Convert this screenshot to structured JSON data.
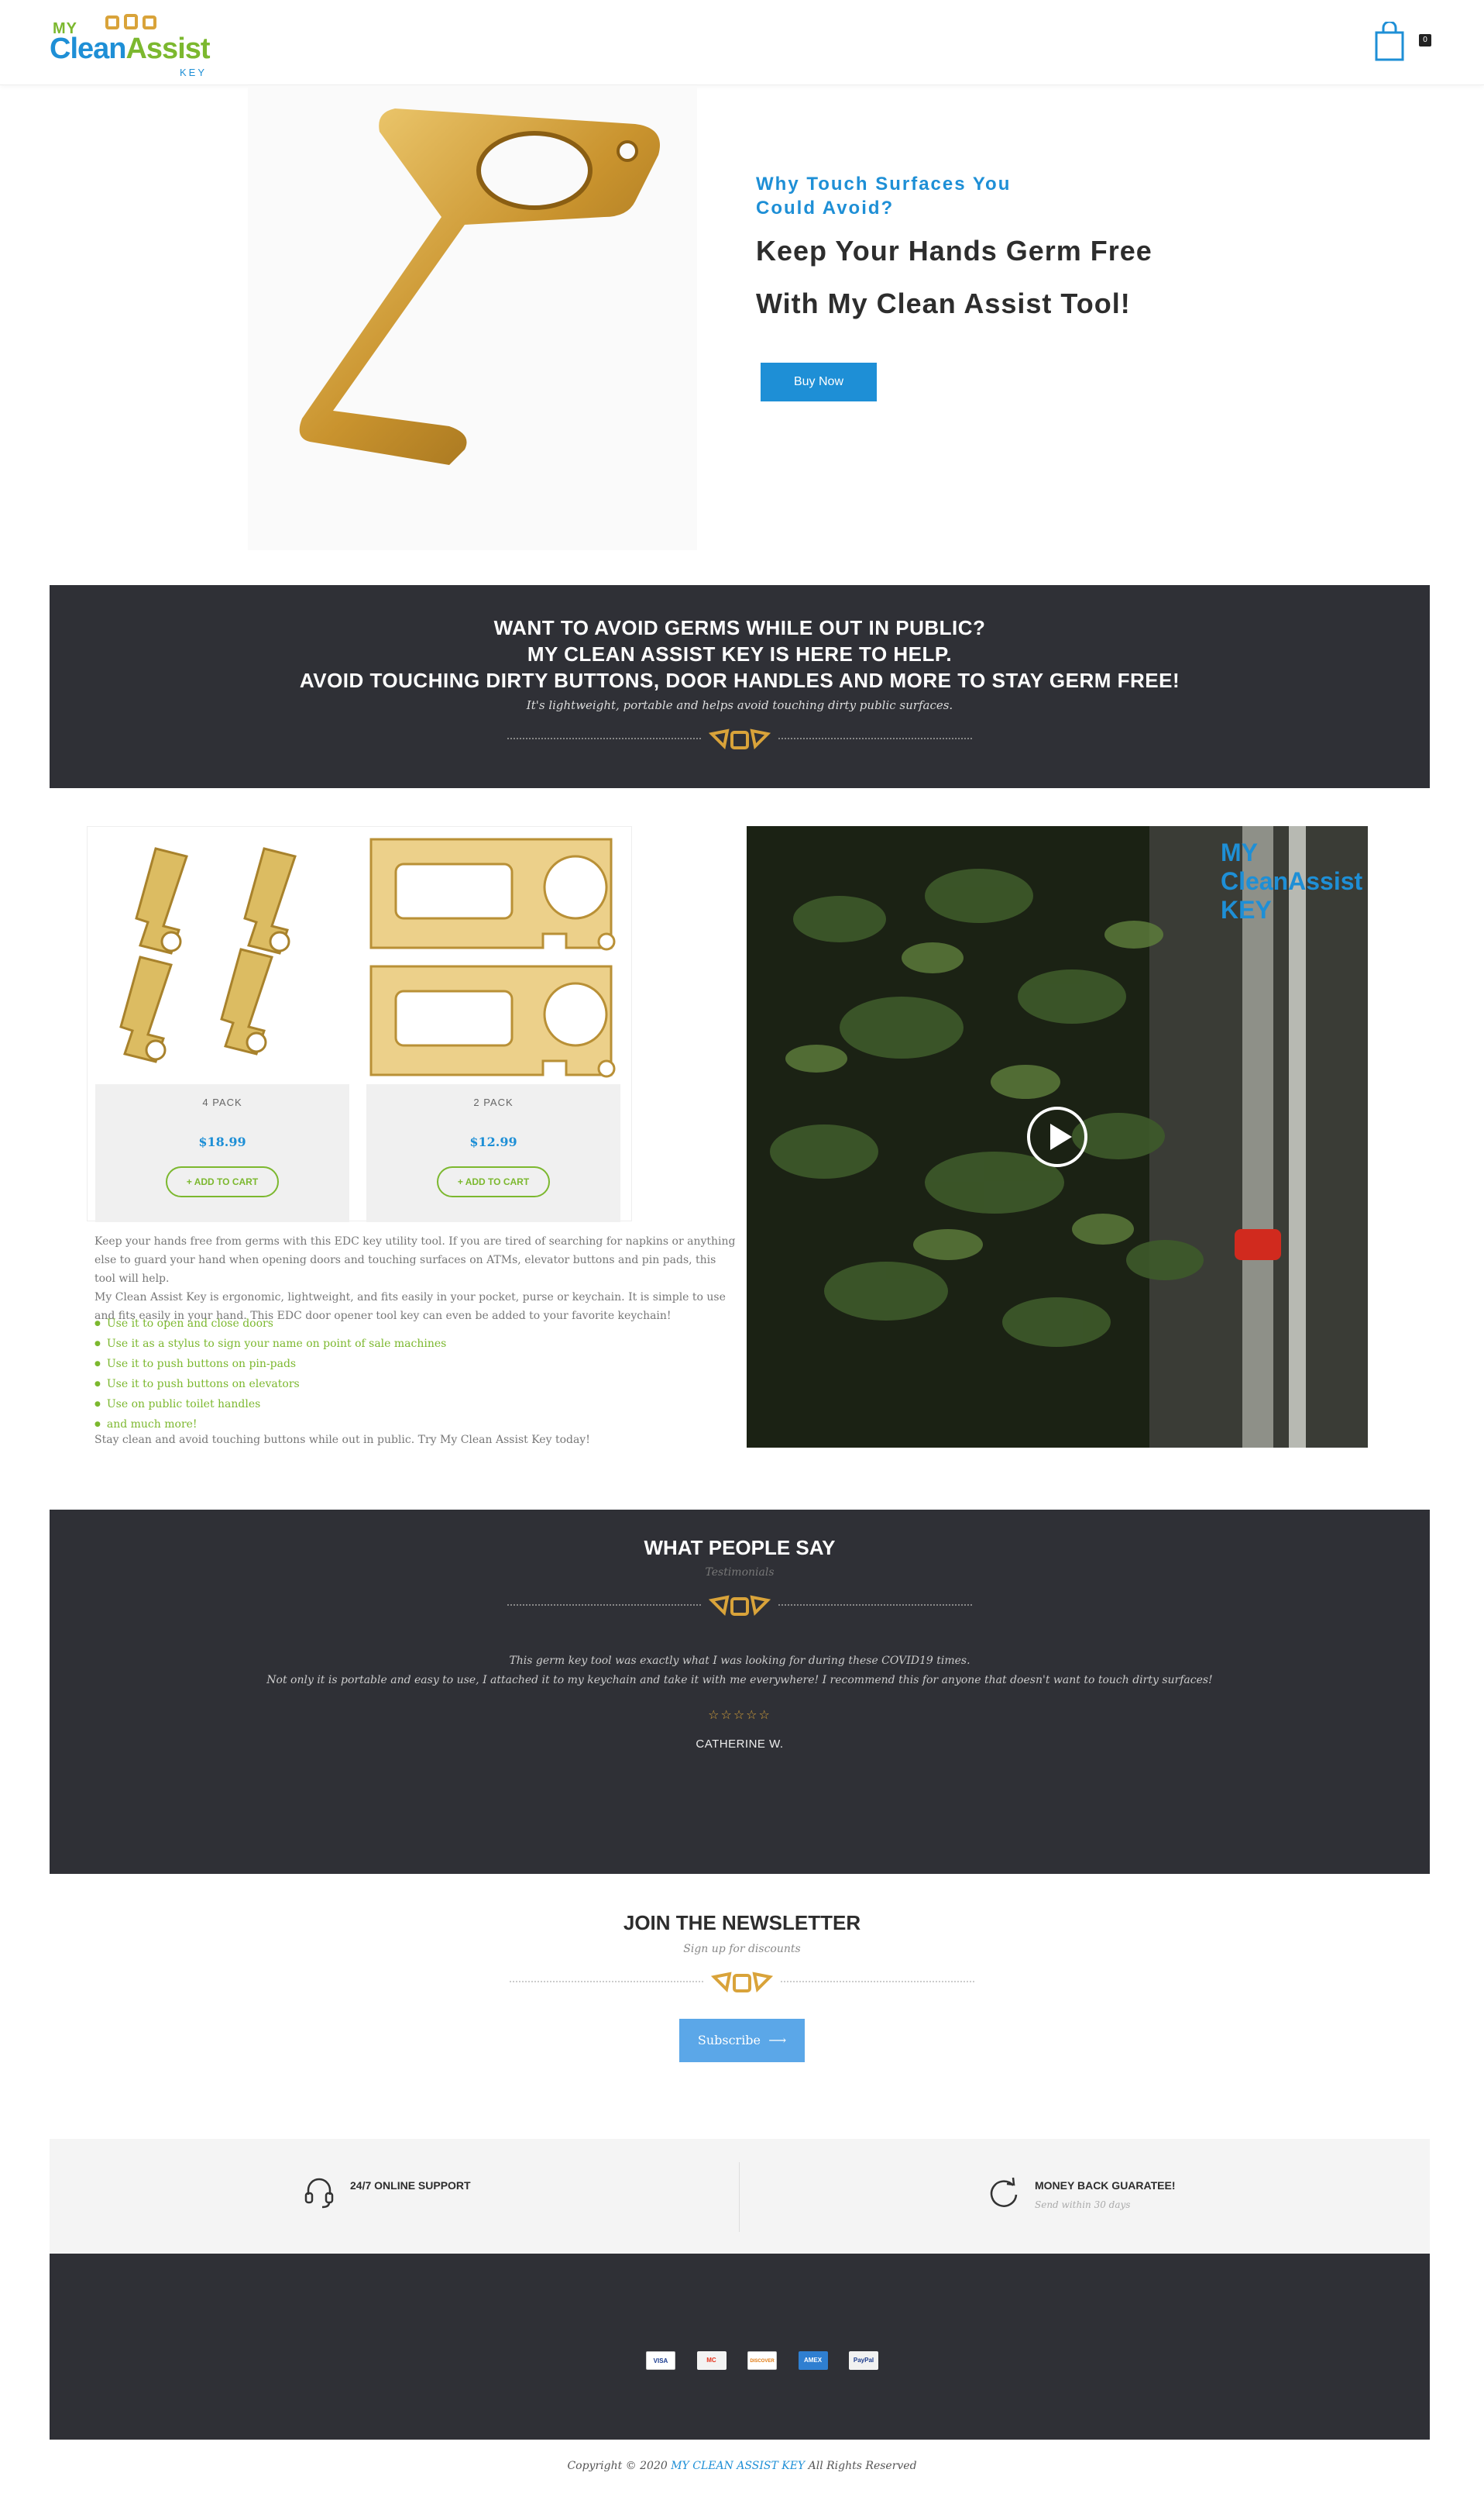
{
  "header": {
    "logo": {
      "my": "MY",
      "clean": "Clean",
      "assist": "Assist",
      "key": "KEY"
    },
    "cart_count": "0"
  },
  "hero": {
    "subtitle": "Why Touch Surfaces You Could Avoid?",
    "title_line1": "Keep Your Hands Germ Free",
    "title_line2": "With My Clean Assist Tool!",
    "button": "Buy Now"
  },
  "banner": {
    "line1": "WANT TO AVOID GERMS WHILE OUT IN PUBLIC?",
    "line2": "MY CLEAN ASSIST KEY IS HERE TO HELP.",
    "line3": "AVOID TOUCHING DIRTY BUTTONS, DOOR HANDLES AND MORE TO STAY GERM FREE!",
    "tagline": "It's lightweight, portable and helps avoid touching dirty public surfaces."
  },
  "products": [
    {
      "name": "4 PACK",
      "price": "$18.99",
      "button": "+ ADD TO CART"
    },
    {
      "name": "2 PACK",
      "price": "$12.99",
      "button": "+ ADD TO CART"
    }
  ],
  "description": {
    "p1": "Keep your hands free from germs with this EDC key utility tool. If you are tired of searching for napkins or anything else to guard your hand when opening doors and touching surfaces on ATMs, elevator buttons and pin pads, this tool will help.",
    "p2": "My Clean Assist Key is ergonomic, lightweight, and fits easily in your pocket, purse or keychain. It is simple to use and fits easily in your hand. This EDC door opener tool key can even be added to your favorite keychain!",
    "bullets": [
      "Use it to open and close doors",
      "Use it as a stylus to sign your name on point of sale machines",
      "Use it to push buttons on pin-pads",
      "Use it to push buttons on elevators",
      "Use on public toilet handles",
      "and much more!"
    ],
    "closing": "Stay clean and avoid touching buttons while out in public. Try My Clean Assist Key today!"
  },
  "video": {
    "overlay_logo": "MY CleanAssist KEY"
  },
  "testimonials": {
    "heading": "WHAT PEOPLE SAY",
    "subheading": "Testimonials",
    "quote_line1": "This germ key tool was exactly what I was looking for during these COVID19 times.",
    "quote_line2": "Not only it is portable and easy to use, I attached it to my keychain and take it with me everywhere! I recommend this for anyone that doesn't want to touch dirty surfaces!",
    "stars": "☆☆☆☆☆",
    "author": "CATHERINE W."
  },
  "newsletter": {
    "heading": "JOIN THE NEWSLETTER",
    "subheading": "Sign up for discounts",
    "button": "Subscribe"
  },
  "features": [
    {
      "icon": "headset-icon",
      "title": "24/7 ONLINE SUPPORT",
      "subtitle": ""
    },
    {
      "icon": "refresh-icon",
      "title": "MONEY BACK GUARATEE!",
      "subtitle": "Send within 30 days"
    }
  ],
  "footer": {
    "cards": [
      "VISA",
      "MC",
      "DISCOVER",
      "AMEX",
      "PayPal"
    ],
    "copyright_prefix": "Copyright © 2020",
    "copyright_brand": "MY CLEAN ASSIST KEY",
    "copyright_suffix": "All Rights Reserved"
  },
  "colors": {
    "brand_blue": "#1e8fd6",
    "brand_green": "#7cb82f",
    "dark": "#2f3036",
    "gold": "#d9a33a"
  }
}
